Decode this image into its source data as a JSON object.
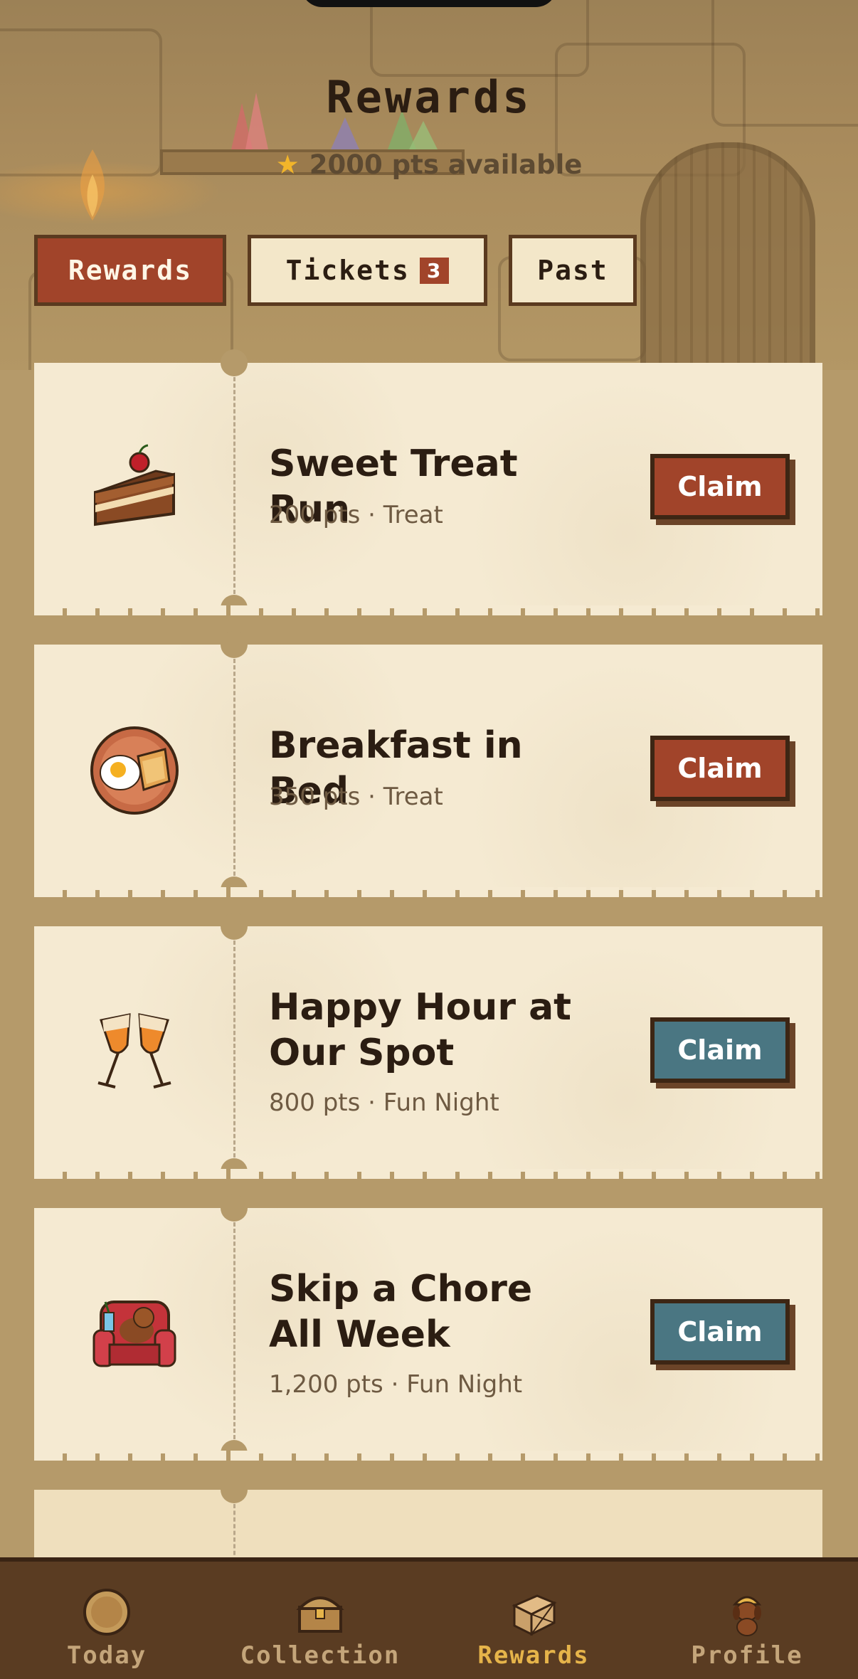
{
  "header": {
    "title": "Rewards",
    "points_text": "2000 pts available",
    "points_icon": "star-icon"
  },
  "tabs": [
    {
      "label": "Rewards",
      "active": true
    },
    {
      "label": "Tickets",
      "badge": "3",
      "active": false
    },
    {
      "label": "Past",
      "active": false
    }
  ],
  "rewards": [
    {
      "name": "Sweet Treat Run",
      "points": "200 pts",
      "category": "Treat",
      "meta": "200 pts  ·  Treat",
      "icon": "cake-slice-icon",
      "button": "Claim",
      "button_color": "#a1442a"
    },
    {
      "name": "Breakfast in Bed",
      "points": "350 pts",
      "category": "Treat",
      "meta": "350 pts  ·  Treat",
      "icon": "breakfast-plate-icon",
      "button": "Claim",
      "button_color": "#a1442a"
    },
    {
      "name_line1": "Happy Hour at",
      "name_line2": "Our Spot",
      "points": "800 pts",
      "category": "Fun Night",
      "meta": "800 pts  ·  Fun Night",
      "icon": "wine-glasses-icon",
      "button": "Claim",
      "button_color": "#4a7682"
    },
    {
      "name_line1": "Skip a Chore",
      "name_line2": "All Week",
      "points": "1,200 pts",
      "category": "Fun Night",
      "meta": "1,200 pts  ·  Fun Night",
      "icon": "armchair-dog-icon",
      "button": "Claim",
      "button_color": "#4a7682"
    }
  ],
  "nav": [
    {
      "label": "Today",
      "icon": "coin-icon",
      "active": false
    },
    {
      "label": "Collection",
      "icon": "treasure-chest-icon",
      "active": false
    },
    {
      "label": "Rewards",
      "icon": "crate-icon",
      "active": true
    },
    {
      "label": "Profile",
      "icon": "miner-dog-icon",
      "active": false
    }
  ],
  "colors": {
    "accent_red": "#a1442a",
    "accent_teal": "#4a7682",
    "paper": "#f5ead2",
    "nav_bg": "#5a3c22",
    "nav_active": "#e6b44a"
  }
}
